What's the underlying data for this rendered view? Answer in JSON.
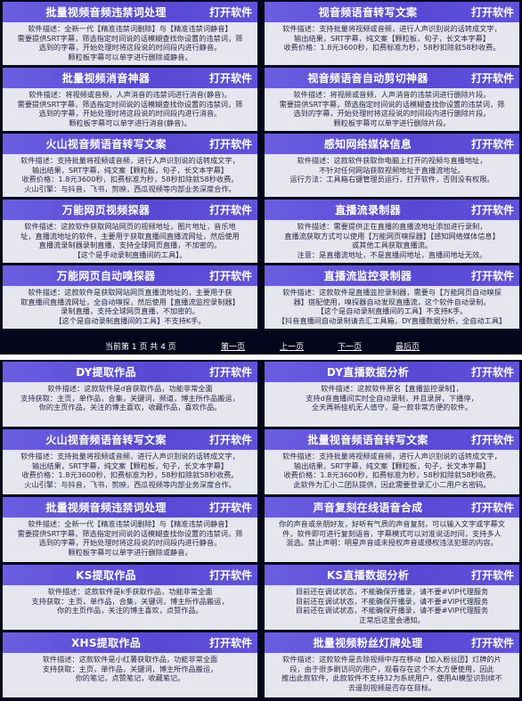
{
  "panel1": {
    "cards": [
      {
        "title": "批量视频音频违禁词处理",
        "button": "打开软件",
        "lines": [
          "软件描述：全新一代【精准违禁词删除】与【精准违禁词静音】",
          "需要提供SRT字幕，筛选指定时间说的话模糊查找你设置的违禁词，筛",
          "选到的字幕，开始处理时将这段说的时间段内进行静音。",
          "颗粒板字幕可以单字进行删除或静音。"
        ]
      },
      {
        "title": "视音频语音转写文案",
        "button": "打开软件",
        "lines": [
          "软件描述：支持批量将视频或音频，进行人声识别说的话转成文字，",
          "输出结果，SRT字幕，纯文案【颗粒板，句子，长文本字幕】",
          "收费价格：1.8元3600秒，扣费标准为秒，58秒扣除就58秒收费。"
        ]
      },
      {
        "title": "批量视频消音神器",
        "button": "打开软件",
        "lines": [
          "软件描述：将视频或音频，人声消音的违禁词进行消音(静音)。",
          "需要提供SRT字幕，筛选指定时间说的话模糊查找你设置的违禁词，筛",
          "选到的字幕，开始处理时将这段说的时间段内进行消音。",
          "颗粒板字幕可以单字进行消音(静音)。"
        ]
      },
      {
        "title": "视音频语音自动剪切神器",
        "button": "打开软件",
        "lines": [
          "软件描述：将视频或音频，人声消音的违禁词进行删除片段。",
          "需要提供SRT字幕，筛选指定时间说的话模糊查找你设置的违禁词，筛",
          "选到的字幕，开始处理时将这段说的时间段内进行删除片段。",
          "颗粒板字幕可以单字进行删除片段。"
        ]
      },
      {
        "title": "火山视音频语音转写文案",
        "button": "打开软件",
        "lines": [
          "软件描述：支持批量将视频或音频，进行人声识别说的话转成文字，",
          "输出结果，SRT字幕，纯文案【颗粒板，句子，长文本字幕】",
          "收费价格：1.8元3600秒，扣费标准为秒，58秒扣除就58秒收费。",
          "火山引擎：与抖音，飞书，剪映，西瓜视频等内部业务深度合作。"
        ]
      },
      {
        "title": "感知网络媒体信息",
        "button": "打开软件",
        "lines": [
          "软件描述：这款软件获取你电脑上打开的视频与直播地址，",
          "不针对任何网站获取视频地址于直播流地址。",
          "运行方法：工具箱右键管理员运行，打开软件，否则没有权限。"
        ]
      },
      {
        "title": "万能网页视频探器",
        "button": "打开软件",
        "lines": [
          "软件描述：这款软件获取网站网页的视频地址，图片地址，音乐地",
          "址，直播流地址的软件，主要用于获取直播间直播流网址，然后使用",
          "直播流录制器录制直播，支持全球网页直播，不加密的。",
          "【这个是手动录制直播间的工具】。"
        ]
      },
      {
        "title": "直播流录制器",
        "button": "打开软件",
        "lines": [
          "软件描述：需要提供正在直播的直播流地址添加进行录制，",
          "直播流获取方式可以使用【万能网页嗅探器】【感知网络媒体信息】",
          "或其他工具获取直播流。",
          "注意：是直播流地址，不是直播间地址，直播间地址无效。"
        ]
      },
      {
        "title": "万能网页自动嗅探器",
        "button": "打开软件",
        "lines": [
          "软件描述：这款软件是获取网站网页直播流地址的，主要用于获",
          "取直播间直播流网址，全自动嗅探，然后使用【直播流监控录制器】",
          "录制直播，支持全球网页直播，不加密的。",
          "【这个是自动录制直播间的工具】不支持K手。"
        ]
      },
      {
        "title": "直播流监控录制器",
        "button": "打开软件",
        "lines": [
          "软件描述：这款软件是直播监控录制器，需要与【万能网页自动嗅探",
          "器】搭配使用，嗅探器自动发现直播流，这个软件自动录制。",
          "【这个是自动录制直播间的工具】不支持K手。",
          "【抖音直播间自动录制请去汇工具箱，DY直播数据分析，全自动工具】"
        ]
      }
    ],
    "pager": {
      "status": "当前第 1 页 共 4 页",
      "first": "第一页",
      "prev": "上一页",
      "next": "下一页",
      "last": "最后页"
    }
  },
  "panel2": {
    "cards": [
      {
        "title": "DY提取作品",
        "button": "打开软件",
        "lines": [
          "软件描述：这款软件是d音获取作品，功能非常全面",
          "支持获取：主页，单作品，合集，关键词，频道，博主所作品搬运，",
          "你的主页作品，关注的博主喜欢，收藏作品，喜欢作品。"
        ]
      },
      {
        "title": "DY直播数据分析",
        "button": "打开软件",
        "lines": [
          "软件描述：这款软件原名【直播监控录制】，",
          "支持d音直播间实时全自动录制，并且录屏，下播停，",
          "全天再新挂机无人值守，是一款非常方便的软件。"
        ]
      },
      {
        "title": "火山视音频语音转写文案",
        "button": "打开软件",
        "lines": [
          "软件描述：支持批量将视频或音频，进行人声识别说的话转成文字，",
          "输出结果，SRT字幕，纯文案【颗粒板，句子，长文本字幕】",
          "收费价格：1.8元3600秒，扣费标准为秒，58秒扣除就58秒收费。",
          "火山引擎：与抖音，飞书，剪映，西瓜视频等内部业务深度合作。"
        ]
      },
      {
        "title": "批量视音频语音转写文案",
        "button": "打开软件",
        "lines": [
          "软件描述：支持批量将视频或音频，进行人声识别说的话转成文字，",
          "输出结果，SRT字幕，纯文案【颗粒板，句子，长文本字幕】",
          "收费价格：1.8元3600秒，扣费标准为秒，58秒扣除就58秒收费。",
          "此软件为汇小二团队提供，因此需要登录汇小二用户名密码。"
        ]
      },
      {
        "title": "批量视频音频违禁词处理",
        "button": "打开软件",
        "lines": [
          "软件描述：全新一代【精准违禁词删除】与【精准违禁词静音】",
          "需要提供SRT字幕，筛选指定时间说的话模糊查找你设置的违禁词，筛",
          "选到的字幕，开始处理时将这段说的时间段内进行静音。",
          "颗粒板字幕可以单字进行删除或静音。"
        ]
      },
      {
        "title": "声音复刻在线语音合成",
        "button": "打开软件",
        "lines": [
          "你的声音或亲朋好友，好听有气质的声音复刻，可以输入文字或字幕文",
          "件，软件即可进行复刻语音，字幕模式可以对准说话时间，支持多人",
          "混选。禁止声明：明星声音或未授权声音或侵权违法犯罪的内容。"
        ]
      },
      {
        "title": "KS提取作品",
        "button": "打开软件",
        "lines": [
          "软件描述：这款软件是k手获取作品，功能非常全面",
          "支持获取：主页，单作品，合集，关键词，博主所作品搬运，",
          "你的主页作品，关注的博主喜欢，点赞作品。"
        ]
      },
      {
        "title": "KS直播数据分析",
        "button": "打开软件",
        "lines": [
          "目前还在调试状态，不能确保开播录，请不要#VIP代理服务",
          "目前还在调试状态，不能确保开播录，请不要#VIP代理服务",
          "目前还在调试状态，不能确保开播录，请不要#VIP代理服务",
          "正常后这里会通知。"
        ]
      },
      {
        "title": "XHS提取作品",
        "button": "打开软件",
        "lines": [
          "软件描述：这款软件是小红薯获取作品，功能非常全面",
          "支持获取：主页，单作品，关键词，博主所作品搬运，",
          "你的笔记，点赞笔记，收藏笔记。"
        ]
      },
      {
        "title": "批量视频粉丝灯牌处理",
        "button": "打开软件",
        "lines": [
          "软件描述：这款软件是去除视频中存在移动【加入粉丝团】灯牌的片",
          "段，由于很多刷访问的用户，观看存在这个不太方便使用，因此",
          "推出此款软件，此款软件不支持32为系统用户，使用AI模型识别续不",
          "去遥别视频是否存在目标。"
        ]
      }
    ]
  }
}
